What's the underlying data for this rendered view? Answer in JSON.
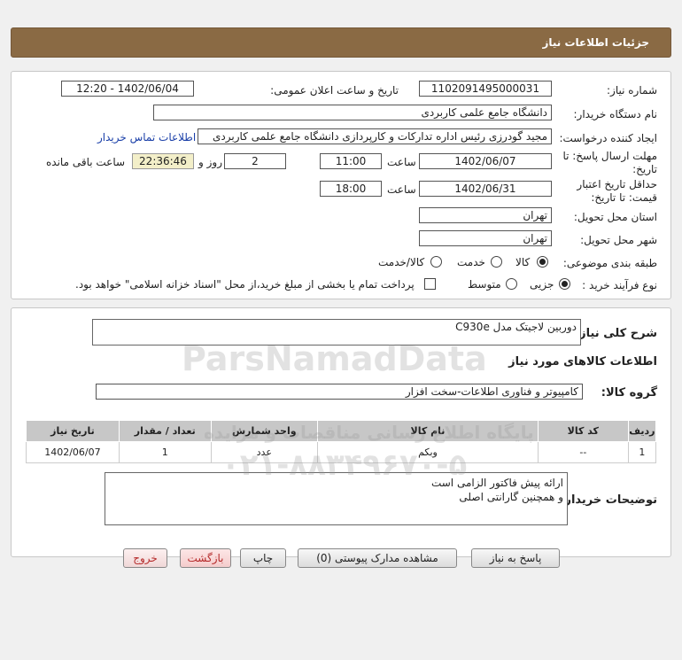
{
  "header": {
    "title": "جزئیات اطلاعات نیاز"
  },
  "form": {
    "need_number_label": "شماره نیاز:",
    "need_number": "1102091495000031",
    "announce_label": "تاریخ و ساعت اعلان عمومی:",
    "announce_value": "1402/06/04 - 12:20",
    "buyer_org_label": "نام دستگاه خریدار:",
    "buyer_org": "دانشگاه جامع علمی کاربردی",
    "requester_label": "ایجاد کننده درخواست:",
    "requester": "مجید گودرزی رئیس اداره تدارکات و کارپردازی دانشگاه جامع علمی کاربردی",
    "contact_link": "اطلاعات تماس خریدار",
    "deadline_label_1": "مهلت ارسال پاسخ: تا",
    "deadline_label_2": "تاریخ:",
    "deadline_date": "1402/06/07",
    "time_label": "ساعت",
    "deadline_time": "11:00",
    "days_value": "2",
    "days_label": "روز و",
    "remaining_time": "22:36:46",
    "remaining_label": "ساعت باقی مانده",
    "validity_label_1": "حداقل تاریخ اعتبار",
    "validity_label_2": "قیمت: تا تاریخ:",
    "validity_date": "1402/06/31",
    "validity_time": "18:00",
    "province_label": "استان محل تحویل:",
    "province": "تهران",
    "city_label": "شهر محل تحویل:",
    "city": "تهران",
    "category_label": "طبقه بندی موضوعی:",
    "category_options": [
      "کالا",
      "خدمت",
      "کالا/خدمت"
    ],
    "process_label": "نوع فرآیند خرید :",
    "process_options": [
      "جزیی",
      "متوسط"
    ],
    "payment_note": "پرداخت تمام یا بخشی از مبلغ خرید،از محل \"اسناد خزانه اسلامی\" خواهد بود."
  },
  "summary": {
    "label": "شرح کلی نیاز:",
    "value": "دوربین لاجیتک مدل C930e",
    "goods_info_title": "اطلاعات کالاهای مورد نیاز",
    "group_label": "گروه کالا:",
    "group_value": "کامپیوتر و فناوری اطلاعات-سخت افزار"
  },
  "table": {
    "headers": [
      "ردیف",
      "کد کالا",
      "نام کالا",
      "واحد شمارش",
      "تعداد / مقدار",
      "تاریخ نیاز"
    ],
    "rows": [
      [
        "1",
        "--",
        "وبکم",
        "عدد",
        "1",
        "1402/06/07"
      ]
    ]
  },
  "buyer_notes": {
    "label": "توضیحات خریدار:",
    "line1": "ارائه پیش فاکتور الزامی است",
    "line2": "و همچنین گارانتی اصلی"
  },
  "buttons": {
    "reply": "پاسخ به نیاز",
    "attachments": "مشاهده مدارک پیوستی (0)",
    "print": "چاپ",
    "back": "بازگشت",
    "exit": "خروج"
  },
  "watermark": {
    "brand": "ParsNamadData",
    "persian_1": "پایگاه اطلاع رسانی مناقصات و مزایده",
    "phone": "۰۲۱-۸۸۳۴۹۶۷۰-۵"
  }
}
